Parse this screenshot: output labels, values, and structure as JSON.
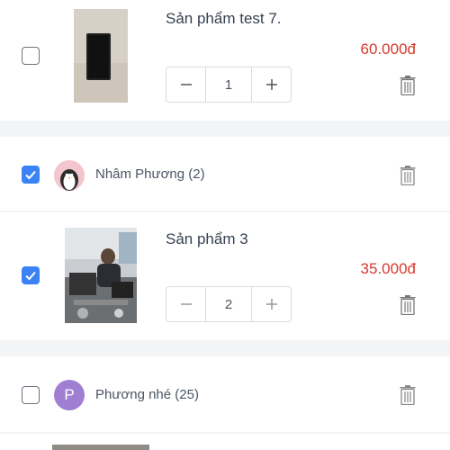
{
  "items": [
    {
      "name": "Sản phẩm test 7.",
      "price": "60.000đ",
      "quantity": "1",
      "checked": false
    },
    {
      "name": "Sản phẩm 3",
      "price": "35.000đ",
      "quantity": "2",
      "checked": true
    }
  ],
  "shops": [
    {
      "name": "Nhâm Phương (2)",
      "checked": true,
      "avatar_icon": "penguin-avatar"
    },
    {
      "name": "Phương nhé (25)",
      "checked": false,
      "avatar_letter": "P",
      "avatar_color": "#a07fd3"
    }
  ],
  "colors": {
    "accent": "#3b82f6",
    "price": "#d9382f"
  }
}
